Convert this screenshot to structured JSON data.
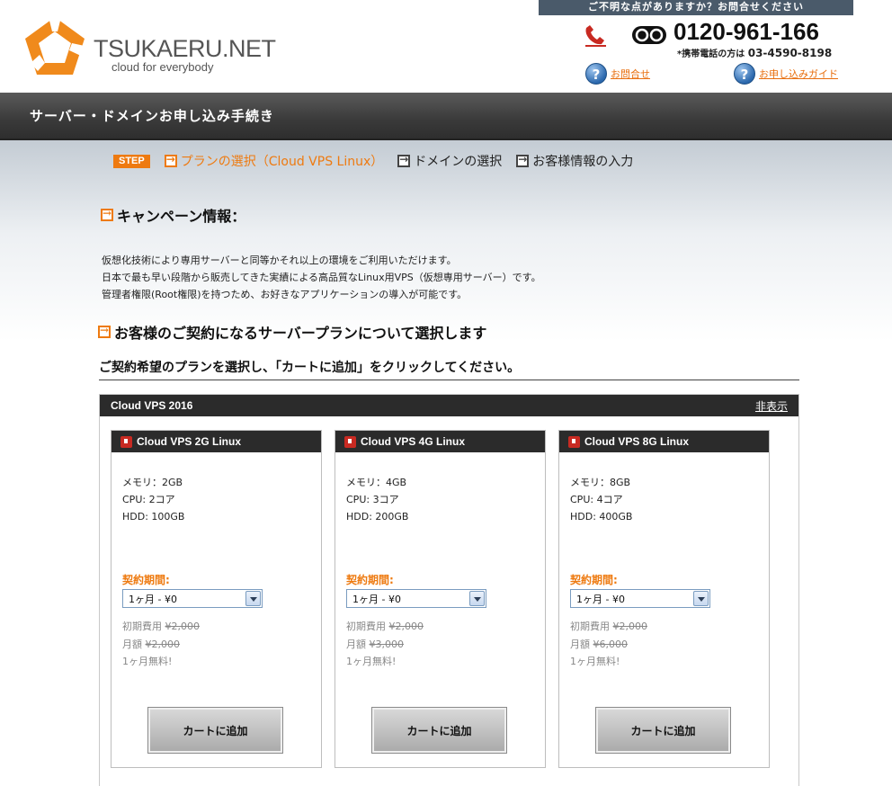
{
  "header": {
    "logo_text": "TSUKAERU.NET",
    "logo_tagline": "cloud for everybody",
    "inquiry_banner": "ご不明な点がありますか？お問合せください",
    "phone_number": "0120-961-166",
    "mobile_label": "*携帯電話の方は",
    "mobile_number": "03-4590-8198",
    "contact_link": "お問合せ",
    "guide_link": "お申し込みガイド"
  },
  "title_bar": {
    "title": "サーバー・ドメインお申し込み手続き"
  },
  "steps": {
    "badge": "STEP",
    "items": [
      {
        "label": "プランの選択（Cloud VPS Linux）",
        "active": true
      },
      {
        "label": "ドメインの選択",
        "active": false
      },
      {
        "label": "お客様情報の入力",
        "active": false
      }
    ]
  },
  "campaign": {
    "heading": "キャンペーン情報：",
    "lines": [
      "仮想化技術により専用サーバーと同等かそれ以上の環境をご利用いただけます。",
      "日本で最も早い段階から販売してきた実績による高品質なLinux用VPS（仮想専用サーバー）です。",
      "管理者権限(Root権限)を持つため、お好きなアプリケーションの導入が可能です。"
    ]
  },
  "plan_section": {
    "heading": "お客様のご契約になるサーバープランについて選択します",
    "instruction": "ご契約希望のプランを選択し、「カートに追加」をクリックしてください。"
  },
  "plan_group": {
    "title": "Cloud VPS 2016",
    "toggle": "非表示",
    "plans": [
      {
        "name": "Cloud VPS 2G Linux",
        "memory": "メモリ：2GB",
        "cpu": "CPU: 2コア",
        "hdd": "HDD: 100GB",
        "contract_label": "契約期間:",
        "contract_value": "1ヶ月 - ¥0",
        "initial_label": "初期費用",
        "initial_price": "¥2,000",
        "monthly_label": "月額",
        "monthly_price": "¥2,000",
        "promo": "1ヶ月無料!",
        "cart_button": "カートに追加"
      },
      {
        "name": "Cloud VPS 4G Linux",
        "memory": "メモリ：4GB",
        "cpu": "CPU: 3コア",
        "hdd": "HDD: 200GB",
        "contract_label": "契約期間:",
        "contract_value": "1ヶ月 - ¥0",
        "initial_label": "初期費用",
        "initial_price": "¥2,000",
        "monthly_label": "月額",
        "monthly_price": "¥3,000",
        "promo": "1ヶ月無料!",
        "cart_button": "カートに追加"
      },
      {
        "name": "Cloud VPS 8G Linux",
        "memory": "メモリ：8GB",
        "cpu": "CPU: 4コア",
        "hdd": "HDD: 400GB",
        "contract_label": "契約期間:",
        "contract_value": "1ヶ月 - ¥0",
        "initial_label": "初期費用",
        "initial_price": "¥2,000",
        "monthly_label": "月額",
        "monthly_price": "¥6,000",
        "promo": "1ヶ月無料!",
        "cart_button": "カートに追加"
      }
    ]
  },
  "colors": {
    "accent": "#ee7a10",
    "dark_bar": "#2b2b2b",
    "logo_orange": "#f08a1c"
  }
}
